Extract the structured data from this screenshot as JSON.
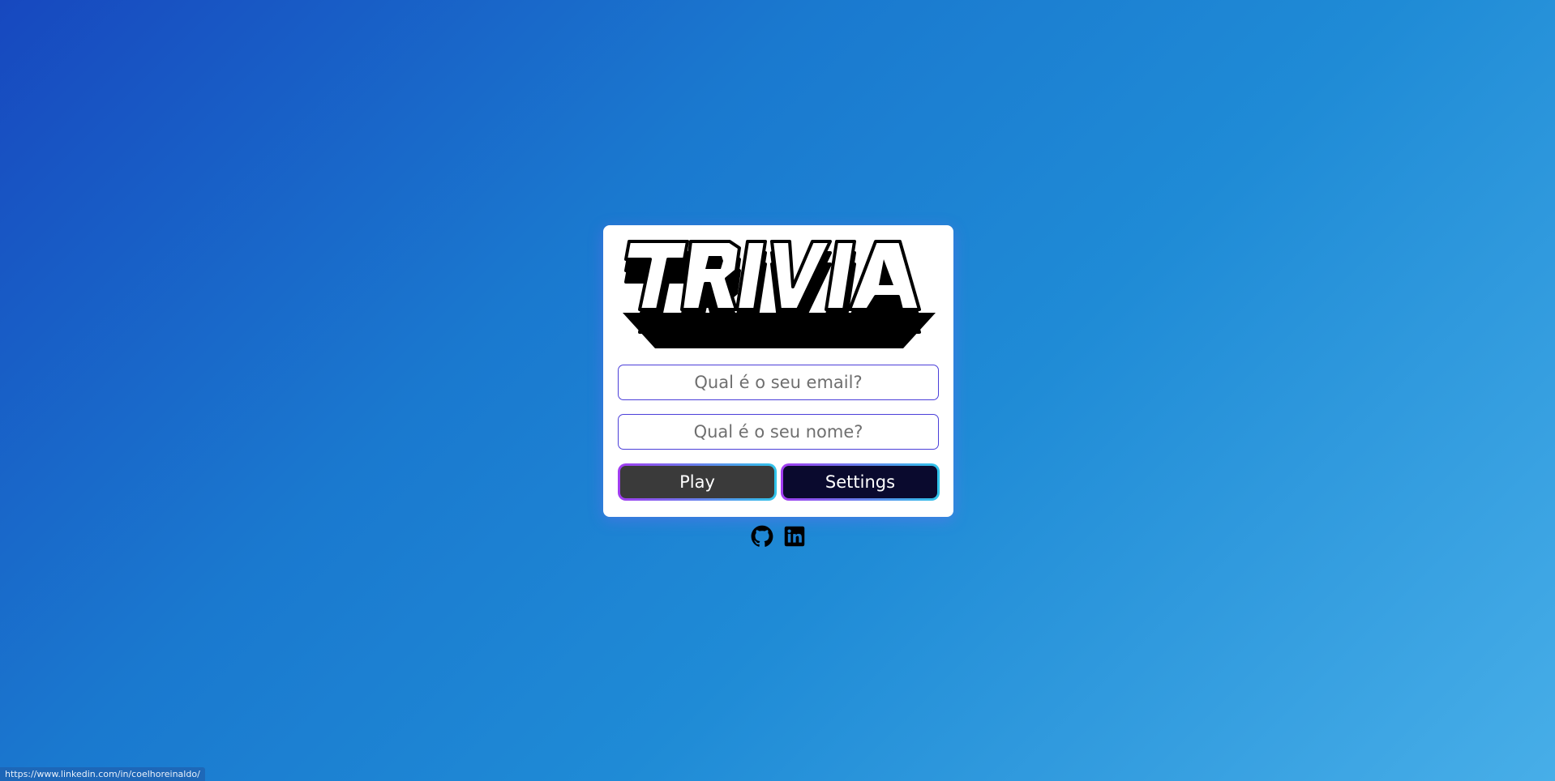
{
  "logo": {
    "text": "TRIVIA",
    "icon": "trivia-logo"
  },
  "form": {
    "email_placeholder": "Qual é o seu email?",
    "name_placeholder": "Qual é o seu nome?",
    "email_value": "",
    "name_value": ""
  },
  "buttons": {
    "play_label": "Play",
    "settings_label": "Settings"
  },
  "socials": [
    {
      "icon": "github-icon"
    },
    {
      "icon": "linkedin-icon"
    }
  ],
  "status_bar": {
    "url": "https://www.linkedin.com/in/coelhoreinaldo/"
  },
  "colors": {
    "background_start": "#1748bf",
    "background_end": "#47aee8",
    "input_border": "#4b3fd9",
    "play_bg": "#3a3a3a",
    "settings_bg": "#0a0a2e",
    "button_border_gradient": [
      "#a23cf0",
      "#2fc4ea"
    ]
  }
}
